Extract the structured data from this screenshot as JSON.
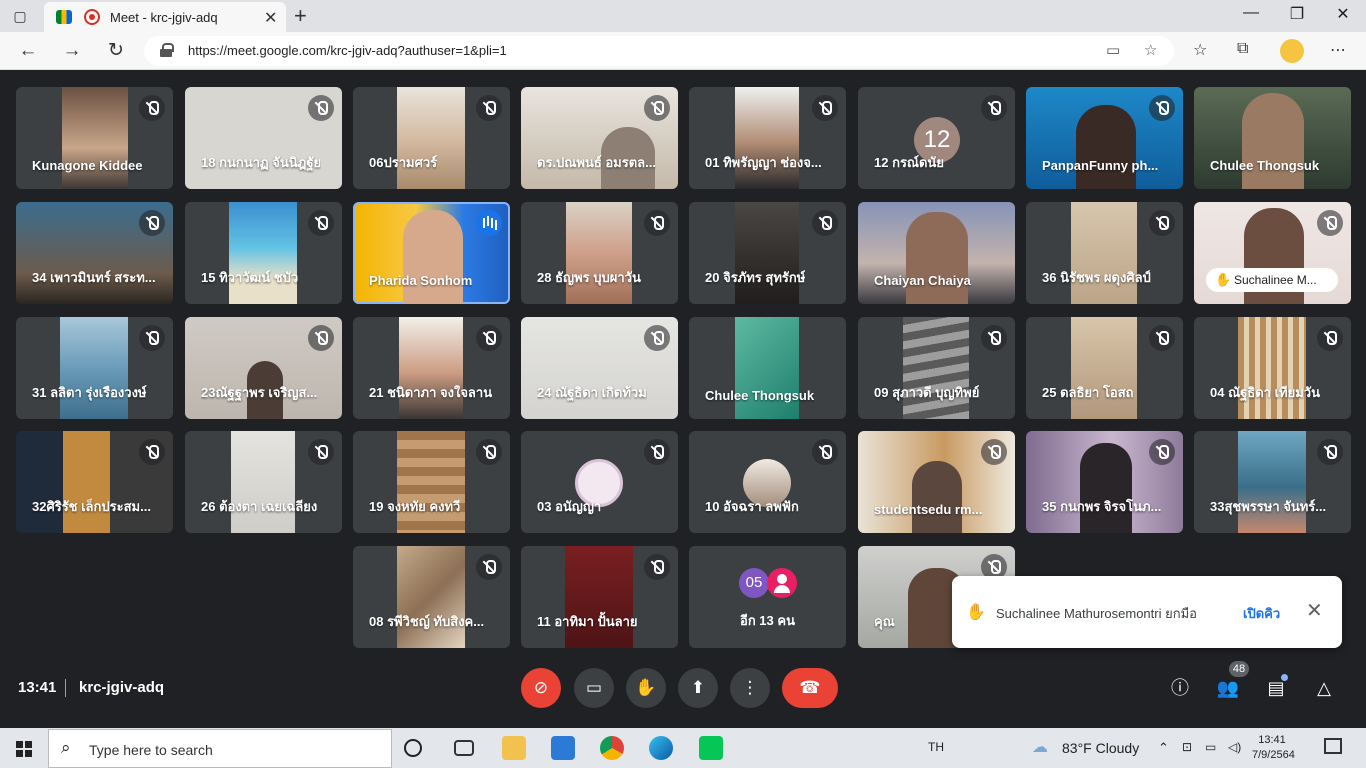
{
  "browser": {
    "tab_title": "Meet - krc-jgiv-adq",
    "url": "https://meet.google.com/krc-jgiv-adq?authuser=1&pli=1"
  },
  "tiles": [
    {
      "name": "Kunagone Kiddee",
      "mic": "off"
    },
    {
      "name": "18 กนกนาฏ จันนิฎฐัย",
      "mic": "off"
    },
    {
      "name": "06ปรามศวร์",
      "mic": "off"
    },
    {
      "name": "ดร.ปณพนธ์ อมรตล...",
      "mic": "off"
    },
    {
      "name": "01 ทิพรัญญา ช่องจ...",
      "mic": "off"
    },
    {
      "name": "12 กรณ์ดนัย",
      "mic": "off",
      "avatar": "12"
    },
    {
      "name": "PanpanFunny ph...",
      "mic": "off"
    },
    {
      "name": "Chulee Thongsuk",
      "mic": "none"
    },
    {
      "name": "34 เพาวมินทร์ สระท...",
      "mic": "off"
    },
    {
      "name": "15 ทิวาวัฒน์ ชบัว",
      "mic": "off"
    },
    {
      "name": "Pharida Sonhom",
      "mic": "speaking"
    },
    {
      "name": "28 ธัญพร บุบผาวัน",
      "mic": "off"
    },
    {
      "name": "20 จิรภัทร สุทรักษ์",
      "mic": "off"
    },
    {
      "name": "Chaiyan Chaiya",
      "mic": "none"
    },
    {
      "name": "36 นิรัชพร ผดุงศิลป์",
      "mic": "off"
    },
    {
      "name": "Suchalinee M...",
      "mic": "off",
      "hand": true
    },
    {
      "name": "31 ลลิตา รุ่งเรืองวงษ์",
      "mic": "off"
    },
    {
      "name": "23ณัฐฐาพร เจริญส...",
      "mic": "off"
    },
    {
      "name": "21 ชนิดาภา จงใจลาน",
      "mic": "off"
    },
    {
      "name": "24 ณัฐธิดา เกิดท้วม",
      "mic": "off"
    },
    {
      "name": "Chulee Thongsuk",
      "mic": "none"
    },
    {
      "name": "09 สุภาวดี บุญทิพย์",
      "mic": "off"
    },
    {
      "name": "25 ดลธิยา โอสถ",
      "mic": "off"
    },
    {
      "name": "04 ณัฐธิดา เทียมวัน",
      "mic": "off"
    },
    {
      "name": "32ศิริรัช เล็กประสม...",
      "mic": "off"
    },
    {
      "name": "26 ต้องตา เฉยเฉลียง",
      "mic": "off"
    },
    {
      "name": "19 จงหทัย คงทวี",
      "mic": "off"
    },
    {
      "name": "03 อนัญญา",
      "mic": "off"
    },
    {
      "name": "10 อัจฉรา ลพฟัก",
      "mic": "off"
    },
    {
      "name": "studentsedu rm...",
      "mic": "off"
    },
    {
      "name": "35 กนกพร จิรจโนภ...",
      "mic": "off"
    },
    {
      "name": "33สุชพรรษา จันทร์...",
      "mic": "off"
    },
    {
      "name": "08 รพีวิชญ์ ทับสิงค...",
      "mic": "off"
    },
    {
      "name": "11 อาทิมา ปั้นลาย",
      "mic": "off"
    },
    {
      "name": "อีก 13 คน",
      "mic": "none",
      "more_avatar": "05"
    },
    {
      "name": "คุณ",
      "mic": "off"
    }
  ],
  "toast": {
    "message": "Suchalinee Mathurosemontri ยกมือ",
    "action": "เปิดคิว"
  },
  "meeting_bar": {
    "time": "13:41",
    "code": "krc-jgiv-adq",
    "people_count": "48"
  },
  "taskbar": {
    "search_placeholder": "Type here to search",
    "language": "TH",
    "weather": "83°F  Cloudy",
    "clock_time": "13:41",
    "clock_date": "7/9/2564"
  }
}
